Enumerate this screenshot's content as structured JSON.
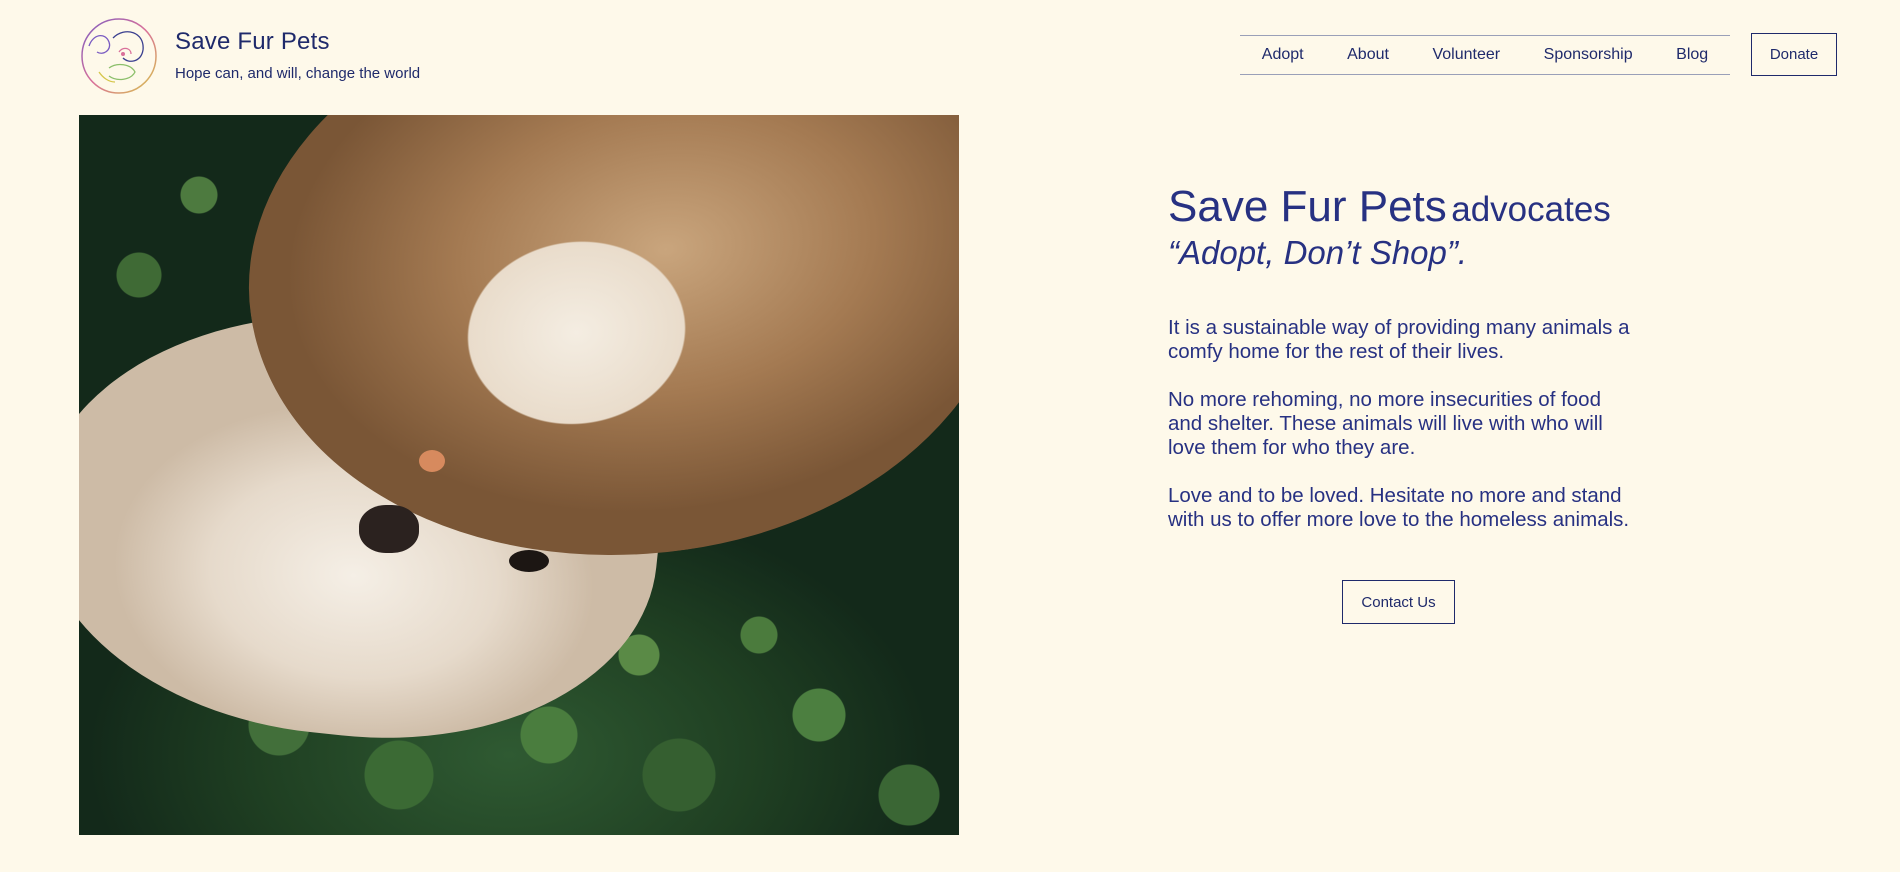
{
  "header": {
    "site_title": "Save Fur Pets",
    "tagline": "Hope can, and will, change the world",
    "logo_icon": "pet-outline-logo",
    "nav_items": [
      "Adopt",
      "About",
      "Volunteer",
      "Sponsorship",
      "Blog"
    ],
    "donate_label": "Donate"
  },
  "hero": {
    "image_subject": "cat-and-dog-lying-in-grass",
    "headline_brand": "Save Fur Pets",
    "headline_verb": "advocates",
    "headline_slogan": "“Adopt, Don’t Shop”.",
    "paragraph_1": "It is a sustainable way of providing many animals a comfy home for the rest of their lives.",
    "paragraph_2": "No more rehoming, no more insecurities of food and shelter. These animals will live with who will love them for who they are.",
    "paragraph_3": "Love and to be loved. Hesitate no more and stand with us to offer more love to the homeless animals.",
    "contact_label": "Contact Us"
  },
  "colors": {
    "background": "#fef9ea",
    "text": "#1f2a6b",
    "heading": "#273182"
  }
}
